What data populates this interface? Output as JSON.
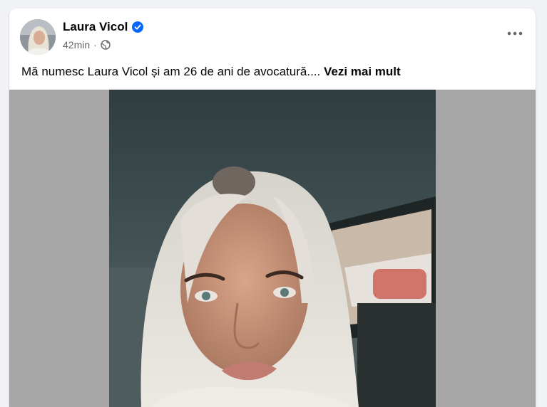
{
  "post": {
    "author_name": "Laura Vicol",
    "verified_icon": "verified-badge-icon",
    "time": "42min",
    "separator": "·",
    "audience_icon": "globe-icon",
    "text": "Mă numesc Laura Vicol și am 26 de ani de avocatură.... ",
    "see_more_label": "Vezi mai mult",
    "more_icon": "more-options-icon"
  },
  "colors": {
    "background": "#f0f2f5",
    "card": "#ffffff",
    "verified_blue": "#0866ff",
    "secondary_text": "#65676b",
    "media_letterbox": "#a6a6a6"
  }
}
